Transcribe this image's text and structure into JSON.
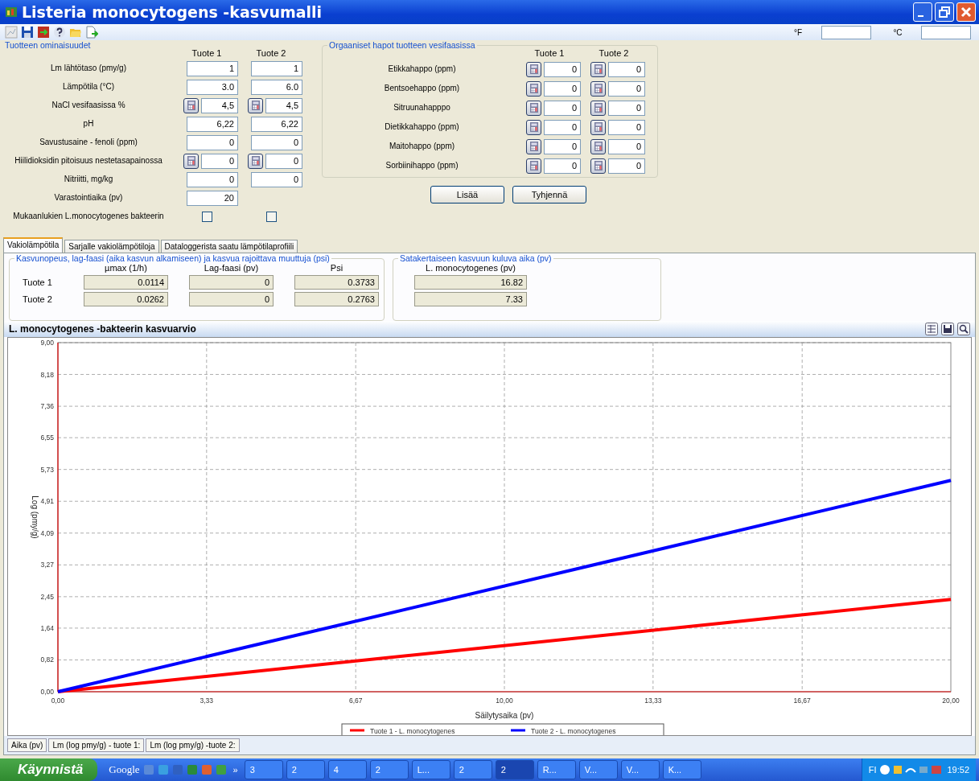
{
  "window": {
    "title": "Listeria monocytogens -kasvumalli"
  },
  "units": [
    {
      "label": "°F"
    },
    {
      "label": "°C"
    }
  ],
  "properties": {
    "title": "Tuotteen ominaisuudet",
    "columns": [
      "Tuote 1",
      "Tuote 2"
    ],
    "rows": [
      {
        "label": "Lm lähtötaso (pmy/g)",
        "kind": "input",
        "values": [
          "1",
          "1"
        ]
      },
      {
        "label": "Lämpötila (°C)",
        "kind": "input",
        "values": [
          "3.0",
          "6.0"
        ]
      },
      {
        "label": "NaCl vesifaasissa %",
        "kind": "calc",
        "values": [
          "4,5",
          "4,5"
        ]
      },
      {
        "label": "pH",
        "kind": "input",
        "values": [
          "6,22",
          "6,22"
        ]
      },
      {
        "label": "Savustusaine - fenoli (ppm)",
        "kind": "input",
        "values": [
          "0",
          "0"
        ]
      },
      {
        "label": "Hiilidioksidin pitoisuus nestetasapainossa",
        "kind": "calc",
        "values": [
          "0",
          "0"
        ]
      },
      {
        "label": "Nitriitti, mg/kg",
        "kind": "input",
        "values": [
          "0",
          "0"
        ]
      },
      {
        "label": "Varastointiaika (pv)",
        "kind": "input",
        "values": [
          "20"
        ]
      },
      {
        "label": "Mukaanlukien L.monocytogenes bakteerin",
        "kind": "checkbox",
        "checks": [
          {
            "checked": false
          },
          {
            "checked": false
          }
        ]
      }
    ]
  },
  "acids": {
    "title": "Orgaaniset hapot tuotteen vesifaasissa",
    "columns": [
      "Tuote 1",
      "Tuote 2"
    ],
    "rows": [
      {
        "label": "Etikkahappo (ppm)",
        "values": [
          "0",
          "0"
        ]
      },
      {
        "label": "Bentsoehappo (ppm)",
        "values": [
          "0",
          "0"
        ]
      },
      {
        "label": "Sitruunahapppo",
        "values": [
          "0",
          "0"
        ]
      },
      {
        "label": "Dietikkahappo (ppm)",
        "values": [
          "0",
          "0"
        ]
      },
      {
        "label": "Maitohappo (ppm)",
        "values": [
          "0",
          "0"
        ]
      },
      {
        "label": "Sorbiinihappo (ppm)",
        "values": [
          "0",
          "0"
        ]
      }
    ]
  },
  "buttons": [
    "Lisää",
    "Tyhjennä"
  ],
  "tabs": [
    {
      "label": "Vakiolämpötila",
      "selected": true
    },
    {
      "label": "Sarjalle vakiolämpötiloja",
      "selected": false
    },
    {
      "label": "Dataloggerista saatu lämpötilaprofiili",
      "selected": false
    }
  ],
  "rates": {
    "title": "Kasvunopeus, lag-faasi (aika kasvun alkamiseen) ja kasvua rajoittava muuttuja (psi)",
    "columns": [
      "µmax (1/h)",
      "Lag-faasi (pv)",
      "Psi"
    ],
    "rows": [
      {
        "label": "Tuote 1",
        "values": [
          "0.0114",
          "0",
          "0.3733"
        ]
      },
      {
        "label": "Tuote 2",
        "values": [
          "0.0262",
          "0",
          "0.2763"
        ]
      }
    ]
  },
  "hundredfold": {
    "title": "Satakertaiseen kasvuun kuluva aika (pv)",
    "column": "L. monocytogenes (pv)",
    "values": [
      "16.82",
      "7.33"
    ]
  },
  "chart": {
    "title": "L. monocytogenes -bakteerin kasvuarvio",
    "chart_data": {
      "type": "line",
      "xlabel": "Säilytysaika (pv)",
      "ylabel": "Log (pmy/g)",
      "x": [
        0,
        20
      ],
      "series": [
        {
          "name": "Tuote 1 - L. monocytogenes",
          "color": "#ff0000",
          "values": [
            0,
            2.38
          ]
        },
        {
          "name": "Tuote 2 - L. monocytogenes",
          "color": "#0000ff",
          "values": [
            0,
            5.45
          ]
        }
      ],
      "xlim": [
        0,
        20
      ],
      "ylim": [
        0,
        9
      ],
      "grid": true,
      "legend": "bottom",
      "xticks": [
        {
          "value": 0,
          "label": "0,00"
        },
        {
          "value": 3.33,
          "label": "3,33"
        },
        {
          "value": 6.67,
          "label": "6,67"
        },
        {
          "value": 10,
          "label": "10,00"
        },
        {
          "value": 13.33,
          "label": "13,33"
        },
        {
          "value": 16.67,
          "label": "16,67"
        },
        {
          "value": 20,
          "label": "20,00"
        }
      ],
      "yticks": [
        {
          "value": 0,
          "label": "0,00"
        },
        {
          "value": 0.82,
          "label": "0,82"
        },
        {
          "value": 1.64,
          "label": "1,64"
        },
        {
          "value": 2.45,
          "label": "2,45"
        },
        {
          "value": 3.27,
          "label": "3,27"
        },
        {
          "value": 4.09,
          "label": "4,09"
        },
        {
          "value": 4.91,
          "label": "4,91"
        },
        {
          "value": 5.73,
          "label": "5,73"
        },
        {
          "value": 6.55,
          "label": "6,55"
        },
        {
          "value": 7.36,
          "label": "7,36"
        },
        {
          "value": 8.18,
          "label": "8,18"
        },
        {
          "value": 9,
          "label": "9,00"
        }
      ]
    }
  },
  "bottom_tabs": [
    "Aika (pv)",
    "Lm (log pmy/g) - tuote 1:",
    "Lm (log pmy/g) -tuote 2:"
  ],
  "taskbar": {
    "start": "Käynnistä",
    "quick": "Google",
    "more": "»",
    "items": [
      {
        "label": "3",
        "selected": false
      },
      {
        "label": "2",
        "selected": false
      },
      {
        "label": "4",
        "selected": false
      },
      {
        "label": "2",
        "selected": false
      },
      {
        "label": "L...",
        "selected": false
      },
      {
        "label": "2",
        "selected": false
      },
      {
        "label": "2",
        "selected": true
      },
      {
        "label": "R...",
        "selected": false
      },
      {
        "label": "V...",
        "selected": false
      },
      {
        "label": "V...",
        "selected": false
      },
      {
        "label": "K...",
        "selected": false
      }
    ],
    "lang": "FI",
    "time": "19:52"
  }
}
